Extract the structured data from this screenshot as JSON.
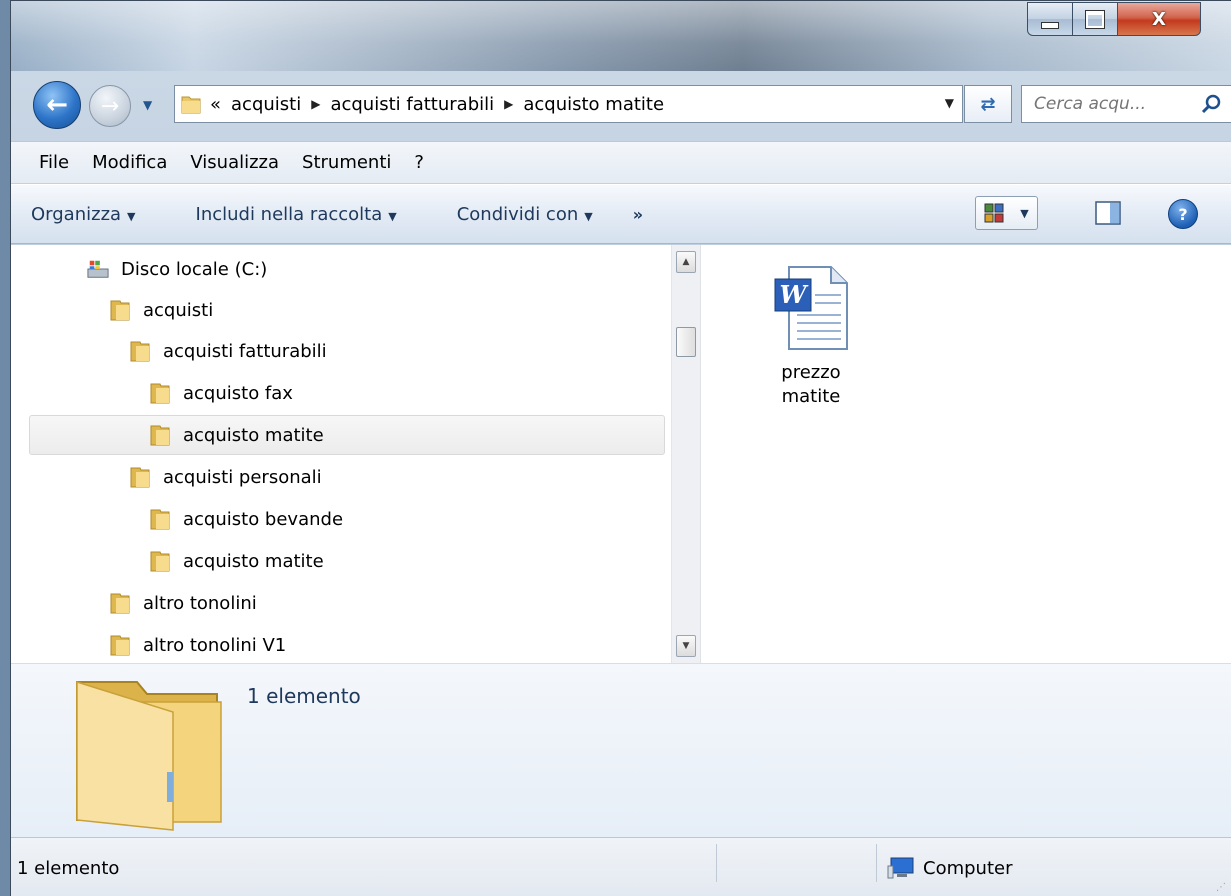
{
  "window": {
    "controls": {
      "close": "X"
    }
  },
  "address": {
    "overflow": "«",
    "crumbs": [
      "acquisti",
      "acquisti fatturabili",
      "acquisto matite"
    ],
    "search_placeholder": "Cerca acqu..."
  },
  "menu": [
    "File",
    "Modifica",
    "Visualizza",
    "Strumenti",
    "?"
  ],
  "commands": {
    "organize": "Organizza",
    "include": "Includi nella raccolta",
    "share": "Condividi con",
    "more": "»"
  },
  "tree": {
    "drive": "Disco locale (C:)",
    "items": [
      "acquisti",
      "acquisti fatturabili",
      "acquisto fax",
      "acquisto matite",
      "acquisti personali",
      "acquisto bevande",
      "acquisto matite",
      "altro tonolini",
      "altro tonolini V1"
    ]
  },
  "content": {
    "file_name": "prezzo matite"
  },
  "details": {
    "count": "1 elemento"
  },
  "status": {
    "count": "1 elemento",
    "location": "Computer"
  }
}
